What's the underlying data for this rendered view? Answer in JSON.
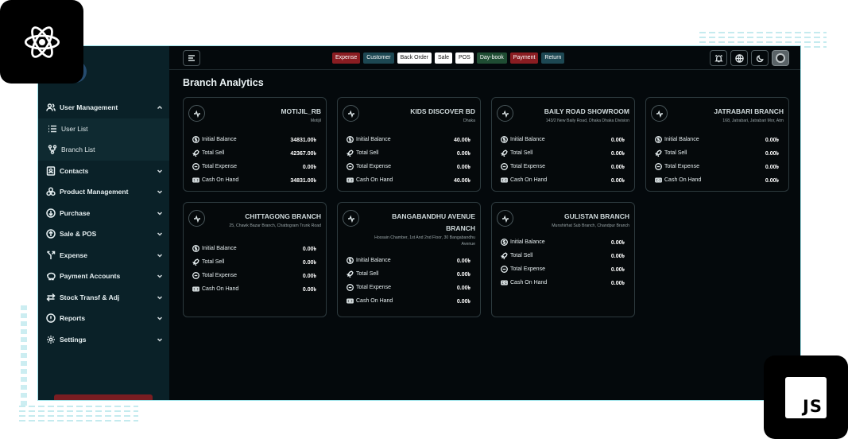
{
  "sidebar": {
    "items": [
      {
        "label": "User Management",
        "icon": "users-icon",
        "expanded": true
      },
      {
        "label": "Contacts",
        "icon": "contacts-icon"
      },
      {
        "label": "Product Management",
        "icon": "boxes-icon"
      },
      {
        "label": "Purchase",
        "icon": "download-circle-icon"
      },
      {
        "label": "Sale & POS",
        "icon": "upload-circle-icon"
      },
      {
        "label": "Expense",
        "icon": "split-arrow-icon"
      },
      {
        "label": "Payment Accounts",
        "icon": "piggy-bank-icon"
      },
      {
        "label": "Stock Transf & Adj",
        "icon": "transfer-icon"
      },
      {
        "label": "Reports",
        "icon": "alert-circle-icon"
      },
      {
        "label": "Settings",
        "icon": "gear-icon"
      }
    ],
    "submenu": [
      {
        "label": "User List",
        "icon": "list-icon"
      },
      {
        "label": "Branch List",
        "icon": "branch-icon"
      }
    ]
  },
  "topbar": {
    "chips": [
      {
        "label": "Expense",
        "color": "#8a1d22"
      },
      {
        "label": "Customer",
        "color": "#1d4853"
      },
      {
        "label": "Back Order",
        "color": "#ffffff"
      },
      {
        "label": "Sale",
        "color": "#ffffff"
      },
      {
        "label": "POS",
        "color": "#ffffff"
      },
      {
        "label": "Day-book",
        "color": "#1f4d33"
      },
      {
        "label": "Payment",
        "color": "#8a1d22"
      },
      {
        "label": "Return",
        "color": "#1d4853"
      }
    ]
  },
  "page": {
    "title": "Branch Analytics"
  },
  "labels": {
    "initial_balance": "Initial Balance",
    "total_sell": "Total Sell",
    "total_expense": "Total Expense",
    "cash_on_hand": "Cash On Hand"
  },
  "branches": [
    {
      "name": "MOTIJIL_RB",
      "address": "Motijil",
      "initial_balance": "34831.00৳",
      "total_sell": "42367.00৳",
      "total_expense": "0.00৳",
      "cash_on_hand": "34831.00৳"
    },
    {
      "name": "KIDS DISCOVER BD",
      "address": "Dhaka",
      "initial_balance": "40.00৳",
      "total_sell": "0.00৳",
      "total_expense": "0.00৳",
      "cash_on_hand": "40.00৳"
    },
    {
      "name": "BAILY ROAD SHOWROOM",
      "address": "143/2 New Baily Road, Dhaka Dhaka Division",
      "initial_balance": "0.00৳",
      "total_sell": "0.00৳",
      "total_expense": "0.00৳",
      "cash_on_hand": "0.00৳"
    },
    {
      "name": "JATRABARI BRANCH",
      "address": "168, Jatrabari, Jatrabari Mor, Atm",
      "initial_balance": "0.00৳",
      "total_sell": "0.00৳",
      "total_expense": "0.00৳",
      "cash_on_hand": "0.00৳"
    },
    {
      "name": "CHITTAGONG BRANCH",
      "address": "25, Chawk Bazar Branch, Chattogram Trunk Road",
      "initial_balance": "0.00৳",
      "total_sell": "0.00৳",
      "total_expense": "0.00৳",
      "cash_on_hand": "0.00৳"
    },
    {
      "name": "BANGABANDHU AVENUE BRANCH",
      "address": "Hossain Chamber, 1st And 2nd Floor, 30 Bangabandhu Avenue",
      "initial_balance": "0.00৳",
      "total_sell": "0.00৳",
      "total_expense": "0.00৳",
      "cash_on_hand": "0.00৳"
    },
    {
      "name": "GULISTAN BRANCH",
      "address": "Munshirhat Sub Branch, Chandpur Branch",
      "initial_balance": "0.00৳",
      "total_sell": "0.00৳",
      "total_expense": "0.00৳",
      "cash_on_hand": "0.00৳"
    }
  ],
  "badges": {
    "js_text": "JS"
  }
}
